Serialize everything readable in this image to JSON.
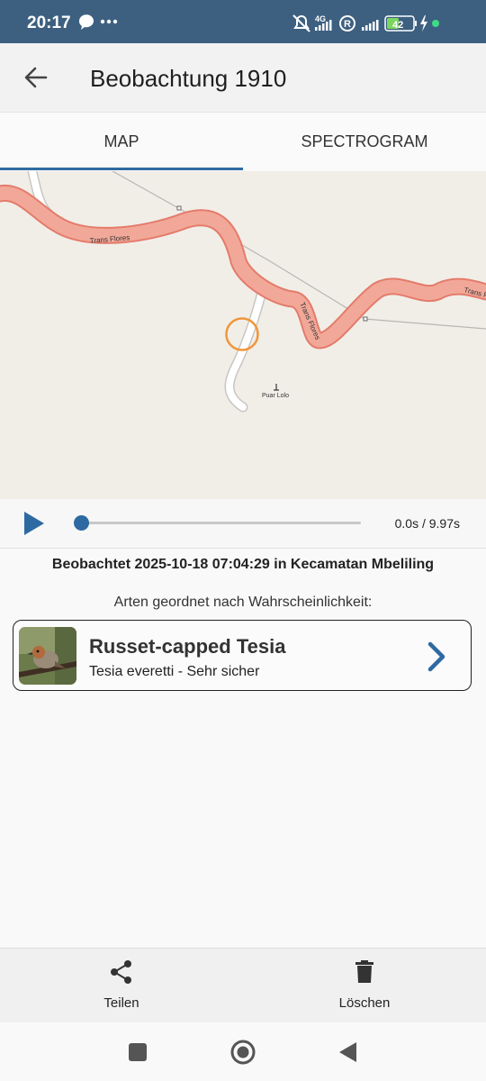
{
  "status_bar": {
    "time": "20:17",
    "network": "4G",
    "battery": "42",
    "icons": [
      "message-icon",
      "more-dots-icon",
      "mute-icon",
      "signal-4g-icon",
      "registered-icon",
      "signal-icon",
      "battery-icon",
      "charging-icon",
      "dot-icon"
    ]
  },
  "app_bar": {
    "title": "Beobachtung 1910",
    "back_icon": "arrow-left-icon"
  },
  "tabs": [
    {
      "label": "MAP",
      "selected": true
    },
    {
      "label": "SPECTROGRAM",
      "selected": false
    }
  ],
  "map": {
    "road_label_1": "Trans Flores",
    "road_label_2": "Trans Flores",
    "road_label_3": "Trans Flo",
    "place_label": "Puar Lolo",
    "colors": {
      "background": "#f1eee8",
      "road_fill": "#f2a898",
      "road_outline": "#e47b6b",
      "marker": "#f0963a"
    }
  },
  "player": {
    "play_icon": "play-icon",
    "time": "0.0s / 9.97s",
    "progress": 0.0,
    "accent": "#2e6aa2"
  },
  "observation": {
    "observed_text": "Beobachtet 2025-10-18 07:04:29 in Kecamatan Mbeliling",
    "species_heading": "Arten geordnet nach Wahrscheinlichkeit:",
    "species": [
      {
        "common_name": "Russet-capped Tesia",
        "scientific_line": "Tesia everetti - Sehr sicher",
        "image_icon": "bird-photo"
      }
    ]
  },
  "actions": [
    {
      "label": "Teilen",
      "icon": "share-icon"
    },
    {
      "label": "Löschen",
      "icon": "trash-icon"
    }
  ],
  "nav_bar": {
    "icons": [
      "recent-apps-icon",
      "home-icon",
      "back-icon"
    ]
  }
}
